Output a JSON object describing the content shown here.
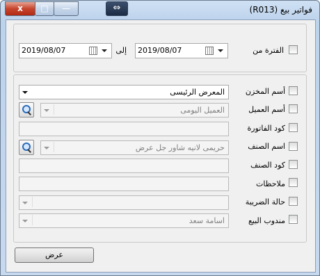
{
  "window": {
    "title": "فواتير بيع  (R013)",
    "close_label": "x",
    "max_label": "□",
    "min_label": "—",
    "resize_label": "⇔"
  },
  "period": {
    "label": "الفترة من",
    "from_date": "2019/08/07",
    "to_label": "إلى",
    "to_date": "2019/08/07"
  },
  "filters": {
    "store": {
      "label": "أسم المخزن",
      "value": "المعرض الرئيسى"
    },
    "client": {
      "label": "أسم العميل",
      "value": "العميل اليومى"
    },
    "invoice_code": {
      "label": "كود الفاتورة",
      "value": ""
    },
    "item_name": {
      "label": "اسم الصنف",
      "value": "حريمى        لانيه شاور جل عرض"
    },
    "item_code": {
      "label": "كود الصنف",
      "value": ""
    },
    "notes": {
      "label": "ملاحظات",
      "value": ""
    },
    "tax_status": {
      "label": "حالة الضريبة",
      "value": ""
    },
    "sales_rep": {
      "label": "مندوب البيع",
      "value": "اسامة سعد"
    }
  },
  "show_button_label": "عرض"
}
